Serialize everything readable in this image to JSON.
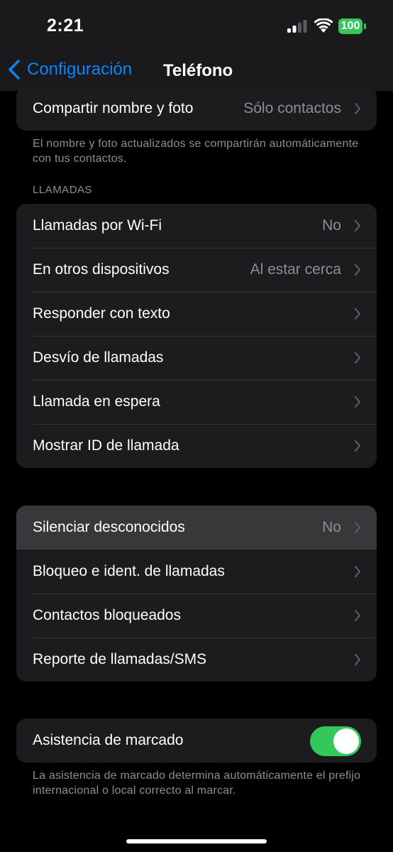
{
  "status_bar": {
    "time": "2:21",
    "battery": "100",
    "icons": [
      "cellular-signal-icon",
      "wifi-icon",
      "battery-icon"
    ]
  },
  "nav": {
    "back_label": "Configuración",
    "back_icon": "chevron-left-icon",
    "title": "Teléfono"
  },
  "colors": {
    "accent": "#0a84ff",
    "toggle_on": "#34c759",
    "row_bg": "#1c1c1e",
    "secondary_text": "#8e8e93"
  },
  "share_group": {
    "row": {
      "label": "Compartir nombre y foto",
      "value": "Sólo contactos"
    },
    "footer": "El nombre y foto actualizados se compartirán automáticamente con tus contactos."
  },
  "calls_group": {
    "header": "LLAMADAS",
    "rows": [
      {
        "label": "Llamadas por Wi-Fi",
        "value": "No"
      },
      {
        "label": "En otros dispositivos",
        "value": "Al estar cerca"
      },
      {
        "label": "Responder con texto",
        "value": ""
      },
      {
        "label": "Desvío de llamadas",
        "value": ""
      },
      {
        "label": "Llamada en espera",
        "value": ""
      },
      {
        "label": "Mostrar ID de llamada",
        "value": ""
      }
    ]
  },
  "blocking_group": {
    "rows": [
      {
        "label": "Silenciar desconocidos",
        "value": "No",
        "highlighted": true
      },
      {
        "label": "Bloqueo e ident. de llamadas",
        "value": ""
      },
      {
        "label": "Contactos bloqueados",
        "value": ""
      },
      {
        "label": "Reporte de llamadas/SMS",
        "value": ""
      }
    ]
  },
  "dial_assist_group": {
    "row": {
      "label": "Asistencia de marcado",
      "toggle_on": true
    },
    "footer": "La asistencia de marcado determina automáticamente el prefijo internacional o local correcto al marcar."
  }
}
